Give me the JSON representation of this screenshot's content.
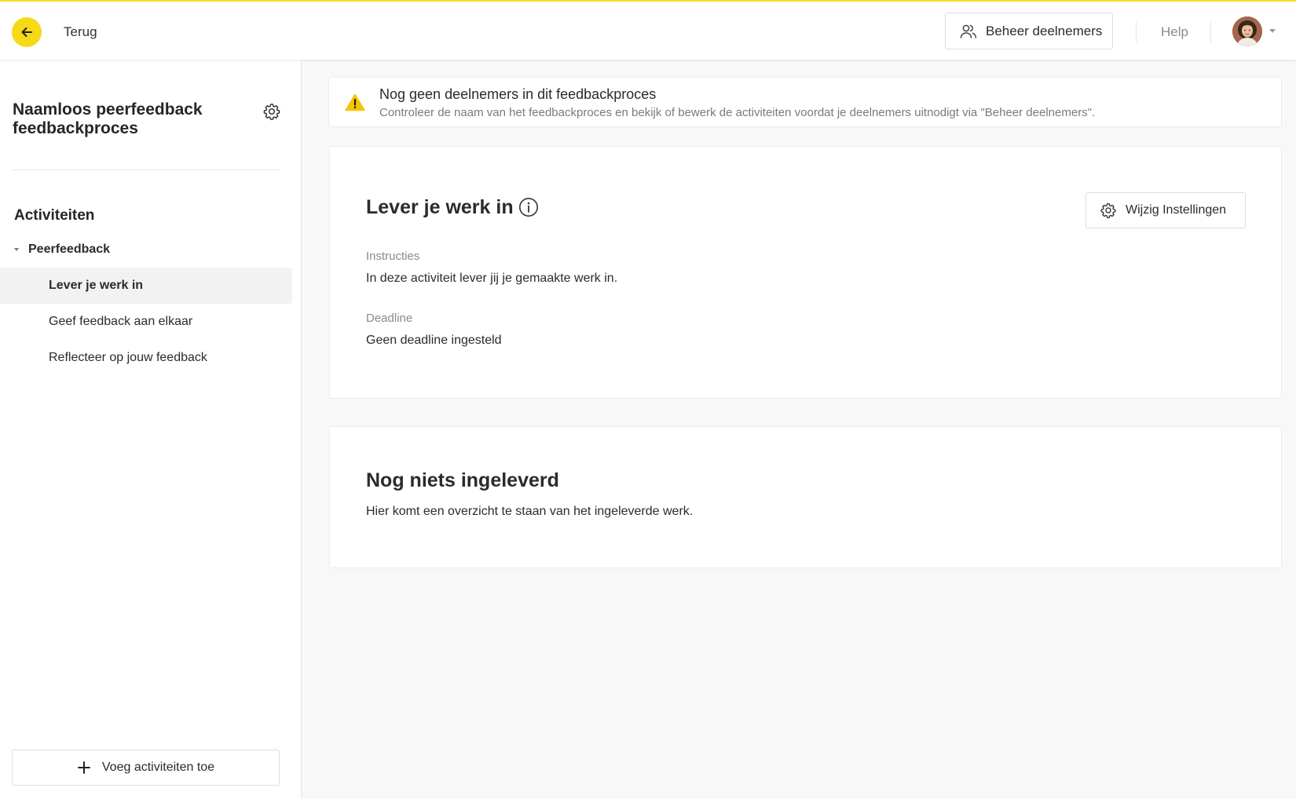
{
  "topbar": {
    "back_label": "Terug",
    "manage_label": "Beheer deelnemers",
    "help_label": "Help"
  },
  "sidebar": {
    "process_title": "Naamloos peerfeedback feedbackproces",
    "activities_heading": "Activiteiten",
    "group_label": "Peerfeedback",
    "items": [
      {
        "label": "Lever je werk in",
        "active": true
      },
      {
        "label": "Geef feedback aan elkaar",
        "active": false
      },
      {
        "label": "Reflecteer op jouw feedback",
        "active": false
      }
    ],
    "add_label": "Voeg activiteiten toe"
  },
  "alert": {
    "title": "Nog geen deelnemers in dit feedbackproces",
    "text": "Controleer de naam van het feedbackproces en bekijk of bewerk de activiteiten voordat je deelnemers uitnodigt via \"Beheer deelnemers\"."
  },
  "activity": {
    "title": "Lever je werk in",
    "settings_label": "Wijzig Instellingen",
    "instructions_label": "Instructies",
    "instructions_value": "In deze activiteit lever jij je gemaakte werk in.",
    "deadline_label": "Deadline",
    "deadline_value": "Geen deadline ingesteld"
  },
  "submissions": {
    "title": "Nog niets ingeleverd",
    "text": "Hier komt een overzicht te staan van het ingeleverde werk."
  },
  "colors": {
    "accent_yellow": "#f7d916",
    "warning_yellow": "#f5c400"
  },
  "icons": [
    "arrow-left-icon",
    "users-icon",
    "gear-icon",
    "warning-icon",
    "info-icon",
    "plus-icon",
    "chevron-down-icon"
  ]
}
